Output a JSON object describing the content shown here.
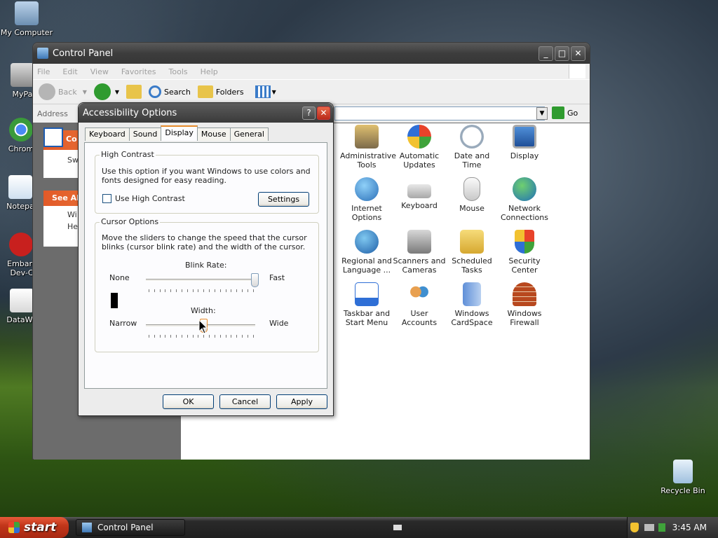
{
  "desktop": {
    "icons": [
      {
        "label": "My Computer"
      },
      {
        "label": "MyPa"
      },
      {
        "label": "Chrom"
      },
      {
        "label": "Notepa"
      },
      {
        "label": "Embarc Dev-C"
      },
      {
        "label": "DataWa"
      },
      {
        "label": "Recycle Bin"
      }
    ]
  },
  "control_panel": {
    "title": "Control Panel",
    "menu": [
      "File",
      "Edit",
      "View",
      "Favorites",
      "Tools",
      "Help"
    ],
    "toolbar": {
      "back": "Back",
      "search": "Search",
      "folders": "Folders"
    },
    "address_label": "Address",
    "go_label": "Go",
    "side_panel": {
      "switch_heading": "Co",
      "switch_item": "Sw",
      "see_also": "See Al",
      "see_also_1": "Wi",
      "see_also_2": "He"
    },
    "items": [
      {
        "label": "Administrative Tools"
      },
      {
        "label": "Automatic Updates"
      },
      {
        "label": "Date and Time"
      },
      {
        "label": "Display"
      },
      {
        "label": "Internet Options"
      },
      {
        "label": "Keyboard"
      },
      {
        "label": "Mouse"
      },
      {
        "label": "Network Connections"
      },
      {
        "label": "Regional and Language ..."
      },
      {
        "label": "Scanners and Cameras"
      },
      {
        "label": "Scheduled Tasks"
      },
      {
        "label": "Security Center"
      },
      {
        "label": "Taskbar and Start Menu"
      },
      {
        "label": "User Accounts"
      },
      {
        "label": "Windows CardSpace"
      },
      {
        "label": "Windows Firewall"
      }
    ]
  },
  "dialog": {
    "title": "Accessibility Options",
    "help_glyph": "?",
    "tabs": [
      "Keyboard",
      "Sound",
      "Display",
      "Mouse",
      "General"
    ],
    "active_tab": "Display",
    "high_contrast": {
      "legend": "High Contrast",
      "description": "Use this option if you want Windows to use colors and fonts designed for easy reading.",
      "checkbox_label": "Use High Contrast",
      "checked": false,
      "settings_button": "Settings"
    },
    "cursor_options": {
      "legend": "Cursor Options",
      "description": "Move the sliders to change the speed that the cursor blinks (cursor blink rate) and the width of the cursor.",
      "blink_label": "Blink Rate:",
      "blink_min": "None",
      "blink_max": "Fast",
      "blink_value": 1.0,
      "width_label": "Width:",
      "width_min": "Narrow",
      "width_max": "Wide",
      "width_value": 0.53
    },
    "buttons": {
      "ok": "OK",
      "cancel": "Cancel",
      "apply": "Apply"
    }
  },
  "taskbar": {
    "start_label": "start",
    "task_label": "Control Panel",
    "clock": "3:45 AM"
  }
}
